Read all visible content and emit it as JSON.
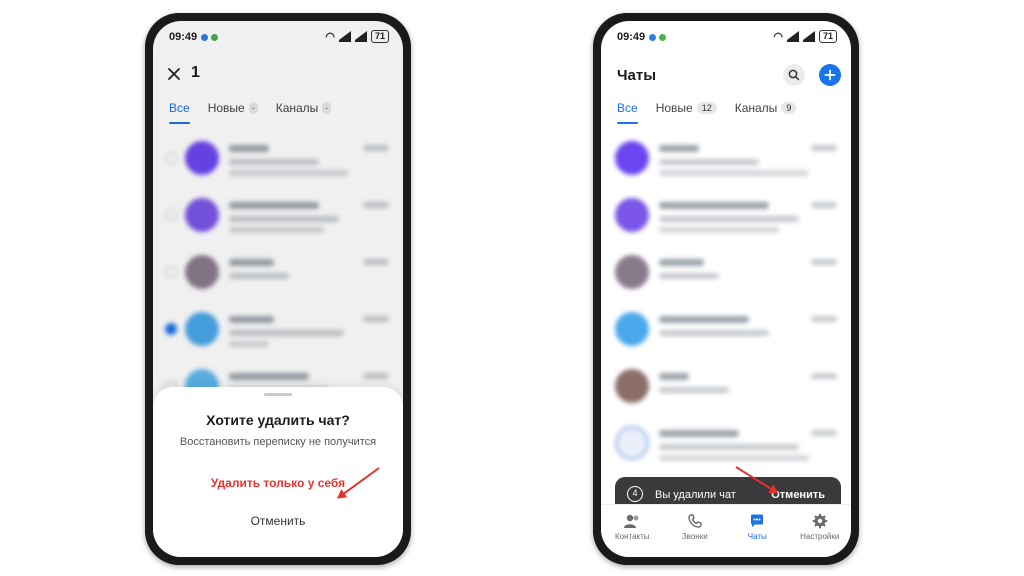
{
  "left_phone": {
    "status": {
      "time": "09:49",
      "battery": "71"
    },
    "header": {
      "close_icon": "close-icon",
      "selected_count": "1"
    },
    "tabs": [
      {
        "label": "Все",
        "active": true
      },
      {
        "label": "Новые",
        "active": false
      },
      {
        "label": "Каналы",
        "active": false
      }
    ],
    "dialog": {
      "title": "Хотите удалить чат?",
      "subtitle": "Восстановить переписку не получится",
      "delete_label": "Удалить только у себя",
      "cancel_label": "Отменить"
    }
  },
  "right_phone": {
    "status": {
      "time": "09:49",
      "battery": "71"
    },
    "header": {
      "title": "Чаты",
      "search_icon": "search-icon",
      "add_icon": "plus-icon"
    },
    "tabs": [
      {
        "label": "Все",
        "active": true,
        "count": ""
      },
      {
        "label": "Новые",
        "active": false,
        "count": "12"
      },
      {
        "label": "Каналы",
        "active": false,
        "count": "9"
      }
    ],
    "toast": {
      "countdown": "4",
      "message": "Вы удалили чат",
      "undo_label": "Отменить"
    },
    "bottom_nav": [
      {
        "label": "Контакты",
        "icon": "contacts-icon"
      },
      {
        "label": "Звонки",
        "icon": "phone-icon"
      },
      {
        "label": "Чаты",
        "icon": "chat-icon",
        "active": true
      },
      {
        "label": "Настройки",
        "icon": "gear-icon"
      }
    ]
  },
  "colors": {
    "accent": "#1a73e8",
    "danger": "#e5322d",
    "toast_bg": "#3a3a3c"
  }
}
